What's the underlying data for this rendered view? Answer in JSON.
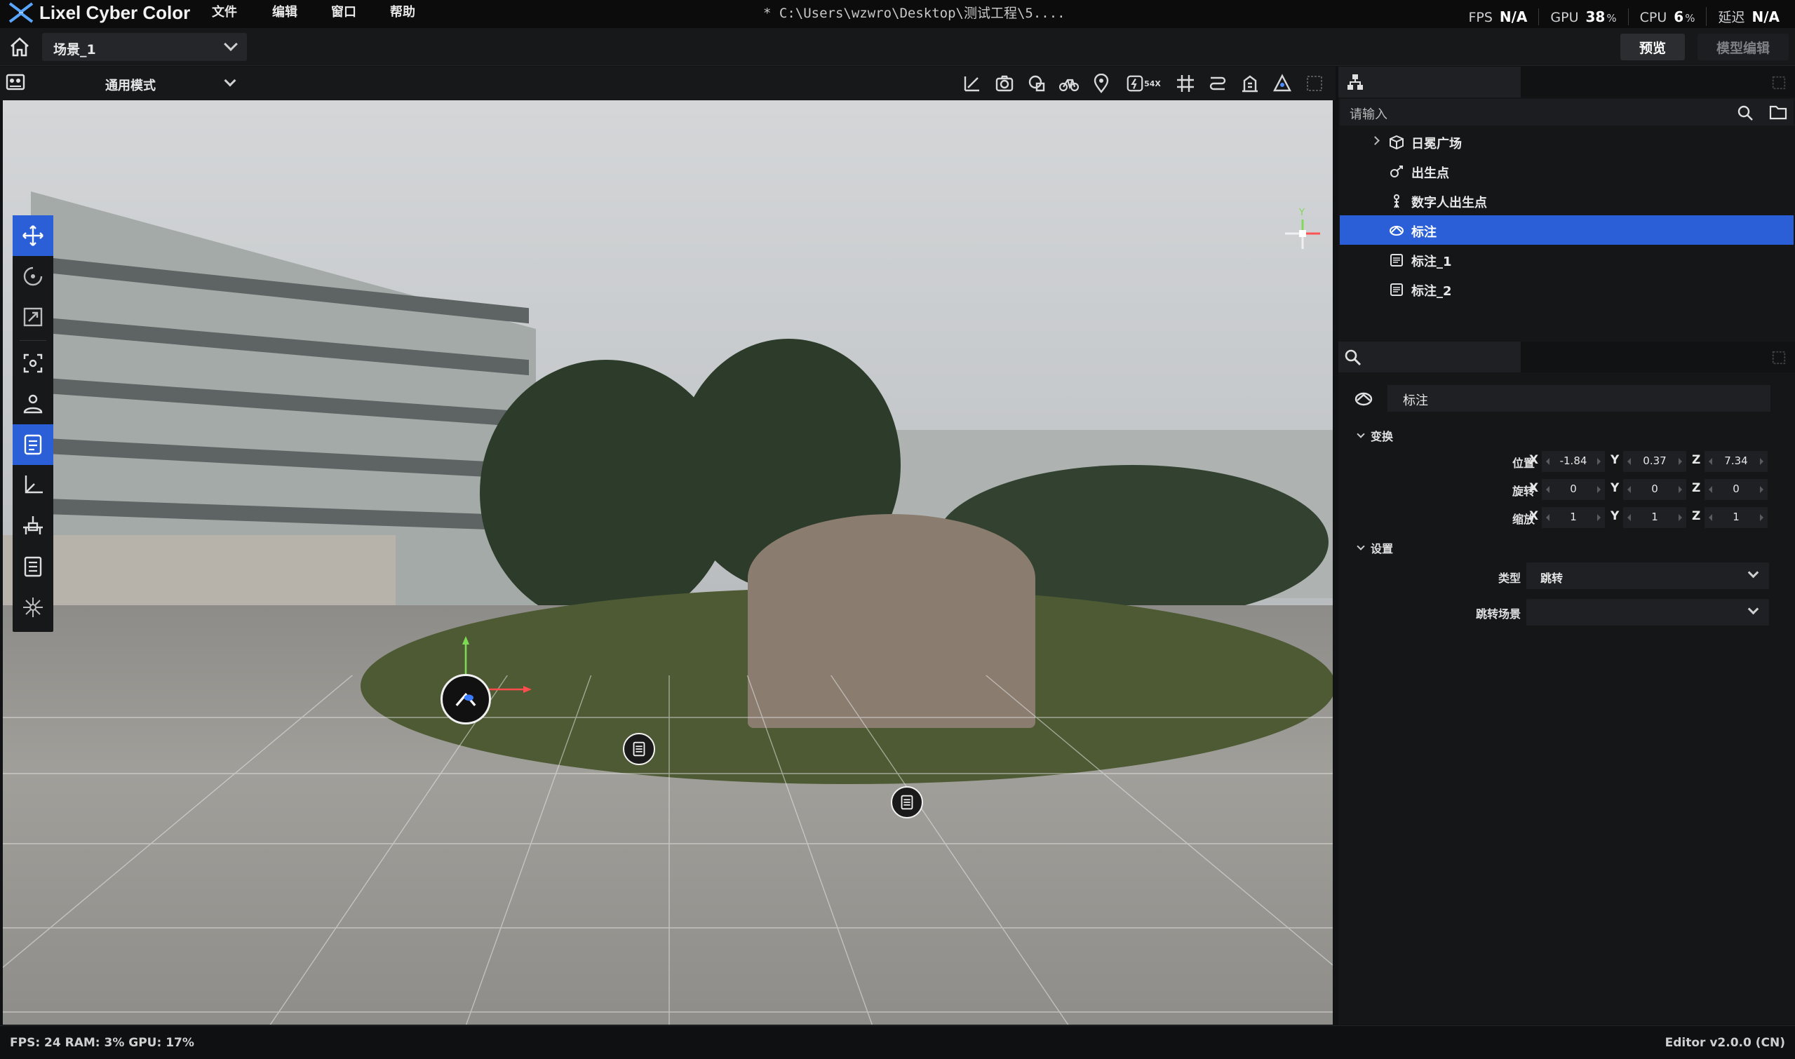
{
  "app": {
    "name": "Lixel Cyber Color",
    "file_path": "* C:\\Users\\wzwro\\Desktop\\测试工程\\5....",
    "menu": [
      "文件",
      "编辑",
      "窗口",
      "帮助"
    ]
  },
  "perf": {
    "fps_label": "FPS",
    "fps_value": "N/A",
    "gpu_label": "GPU",
    "gpu_value": "38",
    "cpu_label": "CPU",
    "cpu_value": "6",
    "pct": "%",
    "latency_label": "延迟",
    "latency_value": "N/A"
  },
  "scenebar": {
    "scene": "场景_1",
    "preview": "预览",
    "model_edit": "模型编辑"
  },
  "viewport_toolbar": {
    "mode": "通用模式",
    "speed_badge": "54X"
  },
  "outliner": {
    "search_placeholder": "请输入",
    "items": [
      {
        "label": "日冕广场",
        "icon": "cube-icon",
        "expandable": true
      },
      {
        "label": "出生点",
        "icon": "spawn-point-icon"
      },
      {
        "label": "数字人出生点",
        "icon": "digital-human-icon"
      },
      {
        "label": "标注",
        "icon": "annotation-group-icon",
        "selected": true
      },
      {
        "label": "标注_1",
        "icon": "annotation-icon"
      },
      {
        "label": "标注_2",
        "icon": "annotation-icon"
      }
    ]
  },
  "inspector": {
    "name": "标注",
    "transform": {
      "title": "变换",
      "position_label": "位置",
      "rotation_label": "旋转",
      "scale_label": "缩放",
      "position": {
        "x": "-1.84",
        "y": "0.37",
        "z": "7.34"
      },
      "rotation": {
        "x": "0",
        "y": "0",
        "z": "0"
      },
      "scale": {
        "x": "1",
        "y": "1",
        "z": "1"
      },
      "axis_x": "X",
      "axis_y": "Y",
      "axis_z": "Z"
    },
    "settings": {
      "title": "设置",
      "type_label": "类型",
      "type_value": "跳转",
      "jump_scene_label": "跳转场景",
      "jump_scene_value": ""
    }
  },
  "viewport": {
    "gizmo_y": "Y"
  },
  "statusbar": {
    "left": "FPS: 24  RAM: 3%  GPU: 17%",
    "right": "Editor v2.0.0 (CN)"
  },
  "colors": {
    "accent": "#2a5fd7",
    "panel": "#151618",
    "titlebar": "#0c0c0d"
  }
}
